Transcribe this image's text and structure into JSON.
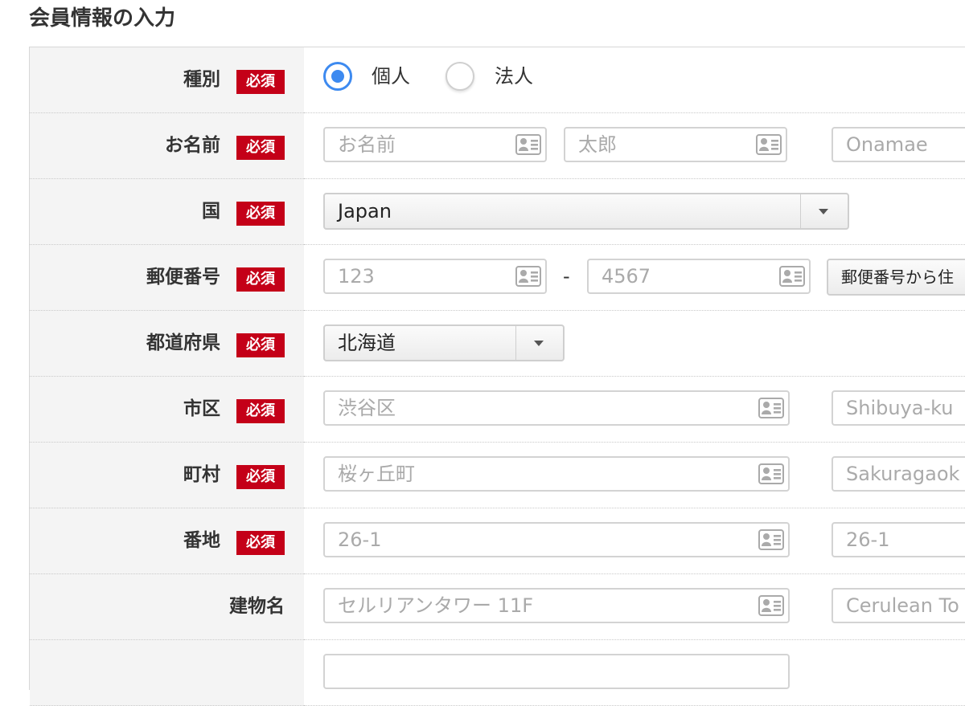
{
  "page": {
    "title": "会員情報の入力"
  },
  "required_label": "必須",
  "rows": {
    "type": {
      "label": "種別",
      "options": [
        {
          "label": "個人",
          "selected": true
        },
        {
          "label": "法人",
          "selected": false
        }
      ]
    },
    "name": {
      "label": "お名前",
      "last_name_placeholder": "お名前",
      "first_name_placeholder": "太郎",
      "romaji_placeholder": "Onamae"
    },
    "country": {
      "label": "国",
      "value": "Japan"
    },
    "postal": {
      "label": "郵便番号",
      "first_placeholder": "123",
      "separator": "-",
      "second_placeholder": "4567",
      "lookup_button": "郵便番号から住"
    },
    "prefecture": {
      "label": "都道府県",
      "value": "北海道"
    },
    "city": {
      "label": "市区",
      "placeholder": "渋谷区",
      "romaji_placeholder": "Shibuya-ku"
    },
    "town": {
      "label": "町村",
      "placeholder": "桜ヶ丘町",
      "romaji_placeholder": "Sakuragaok"
    },
    "address": {
      "label": "番地",
      "placeholder": "26-1",
      "romaji_placeholder": "26-1"
    },
    "building": {
      "label": "建物名",
      "placeholder": "セルリアンタワー 11F",
      "romaji_placeholder": "Cerulean To"
    }
  },
  "colors": {
    "required_badge": "#c40018",
    "radio_accent": "#3d8af0",
    "label_background": "#f4f4f4",
    "input_border": "#d3d3d3"
  },
  "icons": {
    "autofill": "contact-card-icon",
    "select": "chevron-down-icon"
  }
}
